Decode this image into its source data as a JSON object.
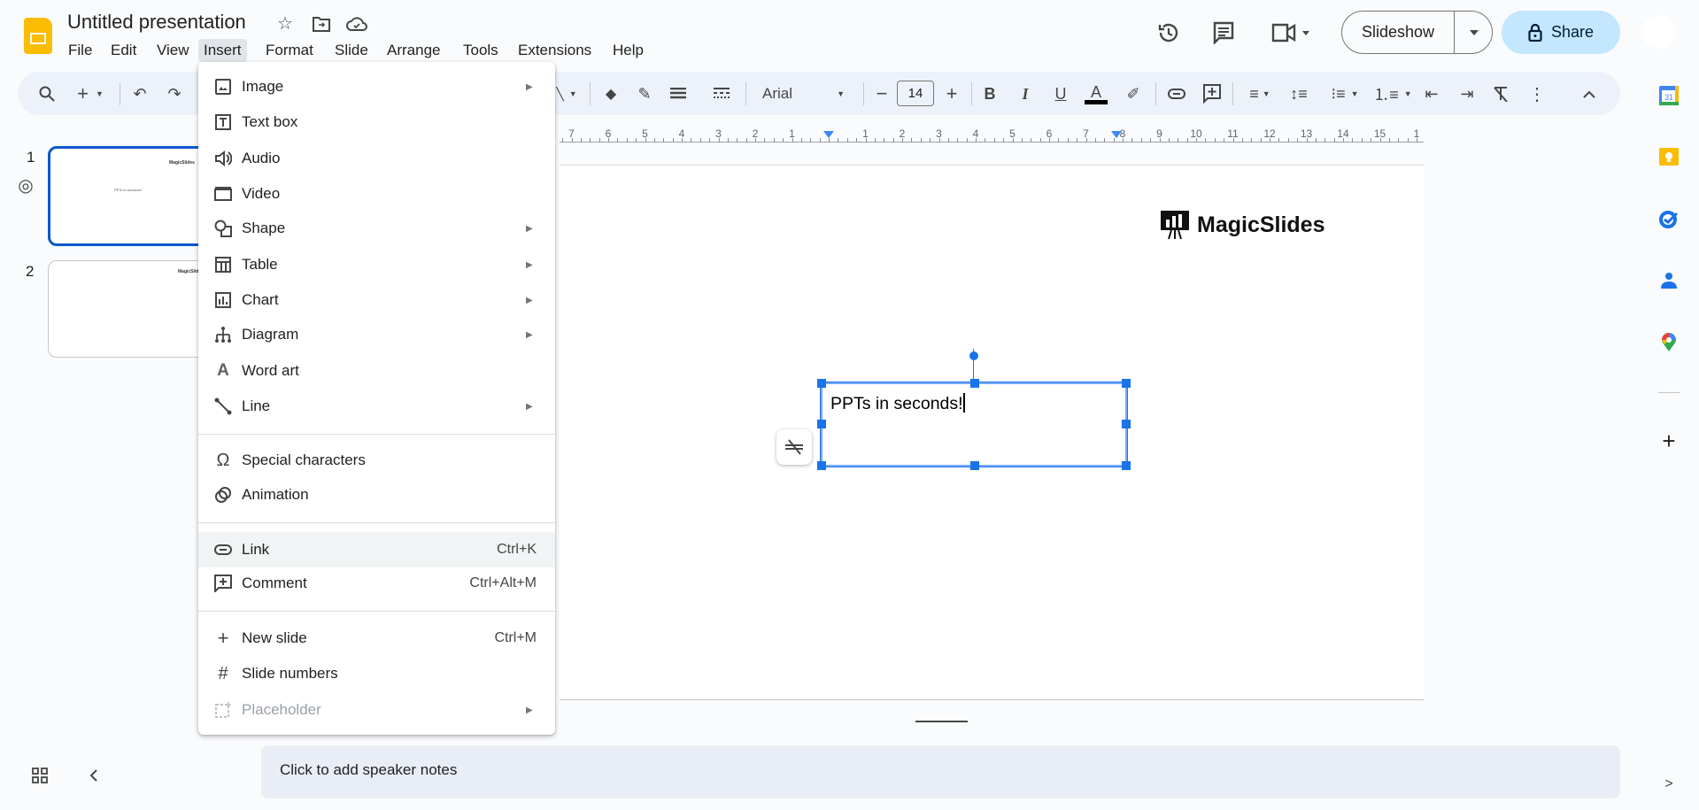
{
  "app": {
    "title": "Untitled presentation",
    "brand_color": "#fbbc04",
    "accent": "#1a73e8"
  },
  "menubar": [
    "File",
    "Edit",
    "View",
    "Insert",
    "Format",
    "Slide",
    "Arrange",
    "Tools",
    "Extensions",
    "Help"
  ],
  "header": {
    "slideshow_label": "Slideshow",
    "share_label": "Share"
  },
  "toolbar": {
    "font": "Arial",
    "font_size": "14"
  },
  "ruler": {
    "left": [
      "7",
      "6",
      "5",
      "4",
      "3",
      "2",
      "1"
    ],
    "right": [
      "1",
      "2",
      "3",
      "4",
      "5",
      "6",
      "7",
      "8",
      "9",
      "10",
      "11",
      "12",
      "13",
      "14",
      "15",
      "1"
    ]
  },
  "filmstrip": [
    {
      "number": "1",
      "logo": "MagicSlides",
      "text": "PPTs in seconds!"
    },
    {
      "number": "2",
      "logo": "MagicSlides"
    }
  ],
  "slide": {
    "logo_text": "MagicSlides",
    "textbox": "PPTs in seconds!"
  },
  "insert_menu": [
    {
      "label": "Image",
      "icon": "image-icon",
      "submenu": true
    },
    {
      "label": "Text box",
      "icon": "textbox-icon"
    },
    {
      "label": "Audio",
      "icon": "audio-icon"
    },
    {
      "label": "Video",
      "icon": "video-icon"
    },
    {
      "label": "Shape",
      "icon": "shape-icon",
      "submenu": true
    },
    {
      "label": "Table",
      "icon": "table-icon",
      "submenu": true
    },
    {
      "label": "Chart",
      "icon": "chart-icon",
      "submenu": true
    },
    {
      "label": "Diagram",
      "icon": "diagram-icon",
      "submenu": true
    },
    {
      "label": "Word art",
      "icon": "word-art-icon"
    },
    {
      "label": "Line",
      "icon": "line-icon",
      "submenu": true
    },
    {
      "separator": true
    },
    {
      "label": "Special characters",
      "icon": "omega-icon"
    },
    {
      "label": "Animation",
      "icon": "animation-icon"
    },
    {
      "separator": true
    },
    {
      "label": "Link",
      "icon": "link-icon",
      "shortcut": "Ctrl+K",
      "highlighted": true
    },
    {
      "label": "Comment",
      "icon": "comment-icon",
      "shortcut": "Ctrl+Alt+M"
    },
    {
      "separator": true
    },
    {
      "label": "New slide",
      "icon": "plus-icon",
      "shortcut": "Ctrl+M"
    },
    {
      "label": "Slide numbers",
      "icon": "hash-icon"
    },
    {
      "label": "Placeholder",
      "icon": "placeholder-icon",
      "submenu": true,
      "disabled": true
    }
  ],
  "notes": {
    "placeholder": "Click to add speaker notes"
  }
}
